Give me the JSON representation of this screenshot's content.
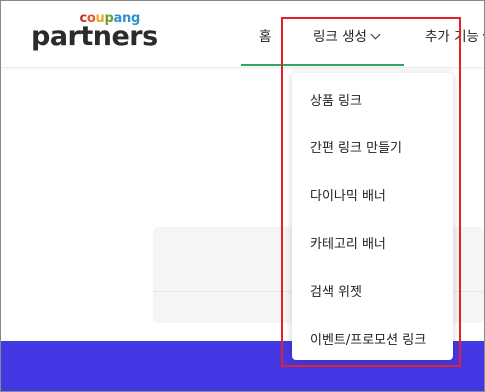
{
  "logo": {
    "letters": [
      {
        "ch": "c",
        "color": "#b5332a"
      },
      {
        "ch": "o",
        "color": "#e9552b"
      },
      {
        "ch": "u",
        "color": "#f2a531"
      },
      {
        "ch": "p",
        "color": "#6f9f32"
      },
      {
        "ch": "a",
        "color": "#2d92d3"
      },
      {
        "ch": "n",
        "color": "#2d92d3"
      },
      {
        "ch": "g",
        "color": "#2d92d3"
      }
    ],
    "brand_top": "coupang",
    "brand_main": "partners"
  },
  "nav": {
    "home": "홈",
    "link_create": "링크 생성",
    "more": "추가 기능"
  },
  "dropdown": {
    "items": [
      "상품 링크",
      "간편 링크 만들기",
      "다이나믹 배너",
      "카테고리 배너",
      "검색 위젯",
      "이벤트/프로모션 링크"
    ]
  },
  "colors": {
    "accent_green": "#2fa75e",
    "banner_blue": "#4339e4",
    "highlight_red": "#e5202a"
  }
}
